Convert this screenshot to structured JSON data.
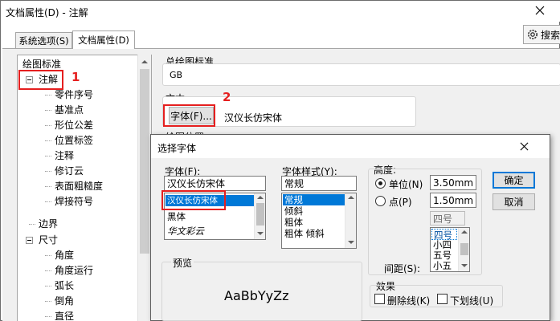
{
  "window": {
    "title": "文档属性(D) - 注解"
  },
  "tabs": [
    {
      "label": "系统选项(S)"
    },
    {
      "label": "文档属性(D)"
    }
  ],
  "search": {
    "label": "搜索"
  },
  "tree": {
    "root": "绘图标准",
    "annotation": "注解",
    "annotation_children": [
      "零件序号",
      "基准点",
      "形位公差",
      "位置标签",
      "注释",
      "修订云",
      "表面粗糙度",
      "焊接符号"
    ],
    "border": "边界",
    "dimension": "尺寸",
    "dimension_children": [
      "角度",
      "角度运行",
      "弧长",
      "倒角",
      "直径"
    ]
  },
  "main": {
    "standard_group": "总绘图标准",
    "standard_value": "GB",
    "text_group": "文本",
    "font_button": "字体(F)...",
    "font_value": "汉仪长仿宋体",
    "layer_group_partial": "绘图位置"
  },
  "annotations": {
    "n1": "1",
    "n2": "2"
  },
  "dialog": {
    "title": "选择字体",
    "font_label": "字体(F):",
    "font_input": "汉仪长仿宋体",
    "font_list": [
      "汉仪长仿宋体",
      "黑体",
      "华文彩云"
    ],
    "style_label": "字体样式(Y):",
    "style_input": "常规",
    "style_list": [
      "常规",
      "倾斜",
      "粗体",
      "粗体 倾斜"
    ],
    "height_label": "高度:",
    "unit_label": "单位(N)",
    "unit_value": "3.50mm",
    "point_label": "点(P)",
    "point_value": "1.50mm",
    "size_input": "四号",
    "size_list": [
      "四号",
      "小四",
      "五号",
      "小五"
    ],
    "spacing_label": "间距(S):",
    "ok_button": "确定",
    "cancel_button": "取消",
    "preview_label": "预览",
    "preview_text": "AaBbYyZz",
    "effects_label": "效果",
    "strikeout_label": "删除线(K)",
    "underline_label": "下划线(U)"
  },
  "colors": {
    "accent": "#0078d7",
    "annotation_red": "#e51f1f"
  }
}
